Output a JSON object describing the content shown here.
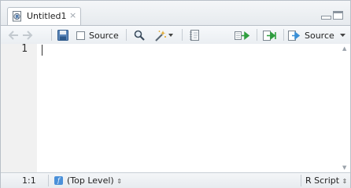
{
  "tab": {
    "title": "Untitled1",
    "close_glyph": "×",
    "icon": "r-script-file-icon"
  },
  "toolbar": {
    "back_icon": "back-arrow-icon",
    "forward_icon": "forward-arrow-icon",
    "save_icon": "save-icon",
    "source_on_save_label": "Source",
    "find_icon": "search-icon",
    "code_tools_icon": "magic-wand-icon",
    "compile_report_icon": "notebook-icon",
    "run_icon": "run-lines-icon",
    "rerun_icon": "rerun-region-icon",
    "source_label": "Source",
    "source_dropdown_icon": "chevron-down-icon"
  },
  "editor": {
    "line_numbers": [
      "1"
    ]
  },
  "status": {
    "cursor_position": "1:1",
    "scope_label": "(Top Level)",
    "scope_icon_glyph": "f",
    "file_type": "R Script",
    "updown_glyph": "⇕"
  },
  "colors": {
    "accent_green": "#2e9e3e",
    "accent_blue": "#4a90d9",
    "border": "#b9c0c8"
  }
}
